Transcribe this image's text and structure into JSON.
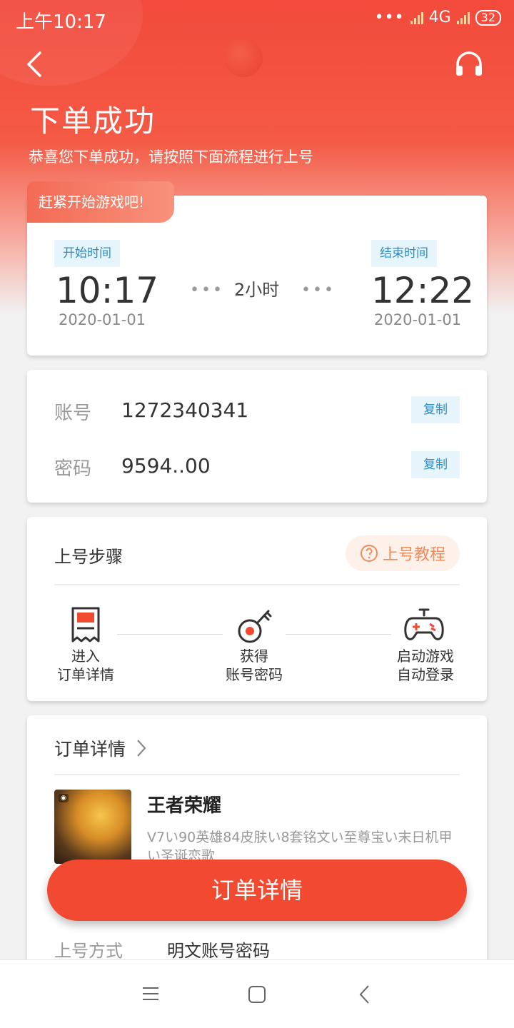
{
  "status_bar": {
    "time": "上午10:17",
    "network": "4G",
    "battery": "32"
  },
  "header": {
    "title": "下单成功",
    "subtitle": "恭喜您下单成功，请按照下面流程进行上号"
  },
  "time_card": {
    "ribbon": "赶紧开始游戏吧!",
    "start_label": "开始时间",
    "start_time": "10:17",
    "start_date": "2020-01-01",
    "duration": "2小时",
    "end_label": "结束时间",
    "end_time": "12:22",
    "end_date": "2020-01-01"
  },
  "account_card": {
    "account_label": "账号",
    "account_value": "1272340341",
    "password_label": "密码",
    "password_value": "9594..00",
    "copy_label": "复制"
  },
  "steps_card": {
    "title": "上号步骤",
    "tutorial_label": "上号教程",
    "steps": [
      {
        "line1": "进入",
        "line2": "订单详情"
      },
      {
        "line1": "获得",
        "line2": "账号密码"
      },
      {
        "line1": "启动游戏",
        "line2": "自动登录"
      }
    ]
  },
  "order_card": {
    "title": "订单详情",
    "game_name": "王者荣耀",
    "game_desc": "V7い90英雄84皮肤い8套铭文い至尊宝い末日机甲い圣诞恋歌",
    "login_method_label": "上号方式",
    "login_method_value": "明文账号密码"
  },
  "main_button": "订单详情",
  "colors": {
    "brand": "#f24a30",
    "tag_bg": "#e6f4fb",
    "tag_text": "#2a8bc9"
  }
}
